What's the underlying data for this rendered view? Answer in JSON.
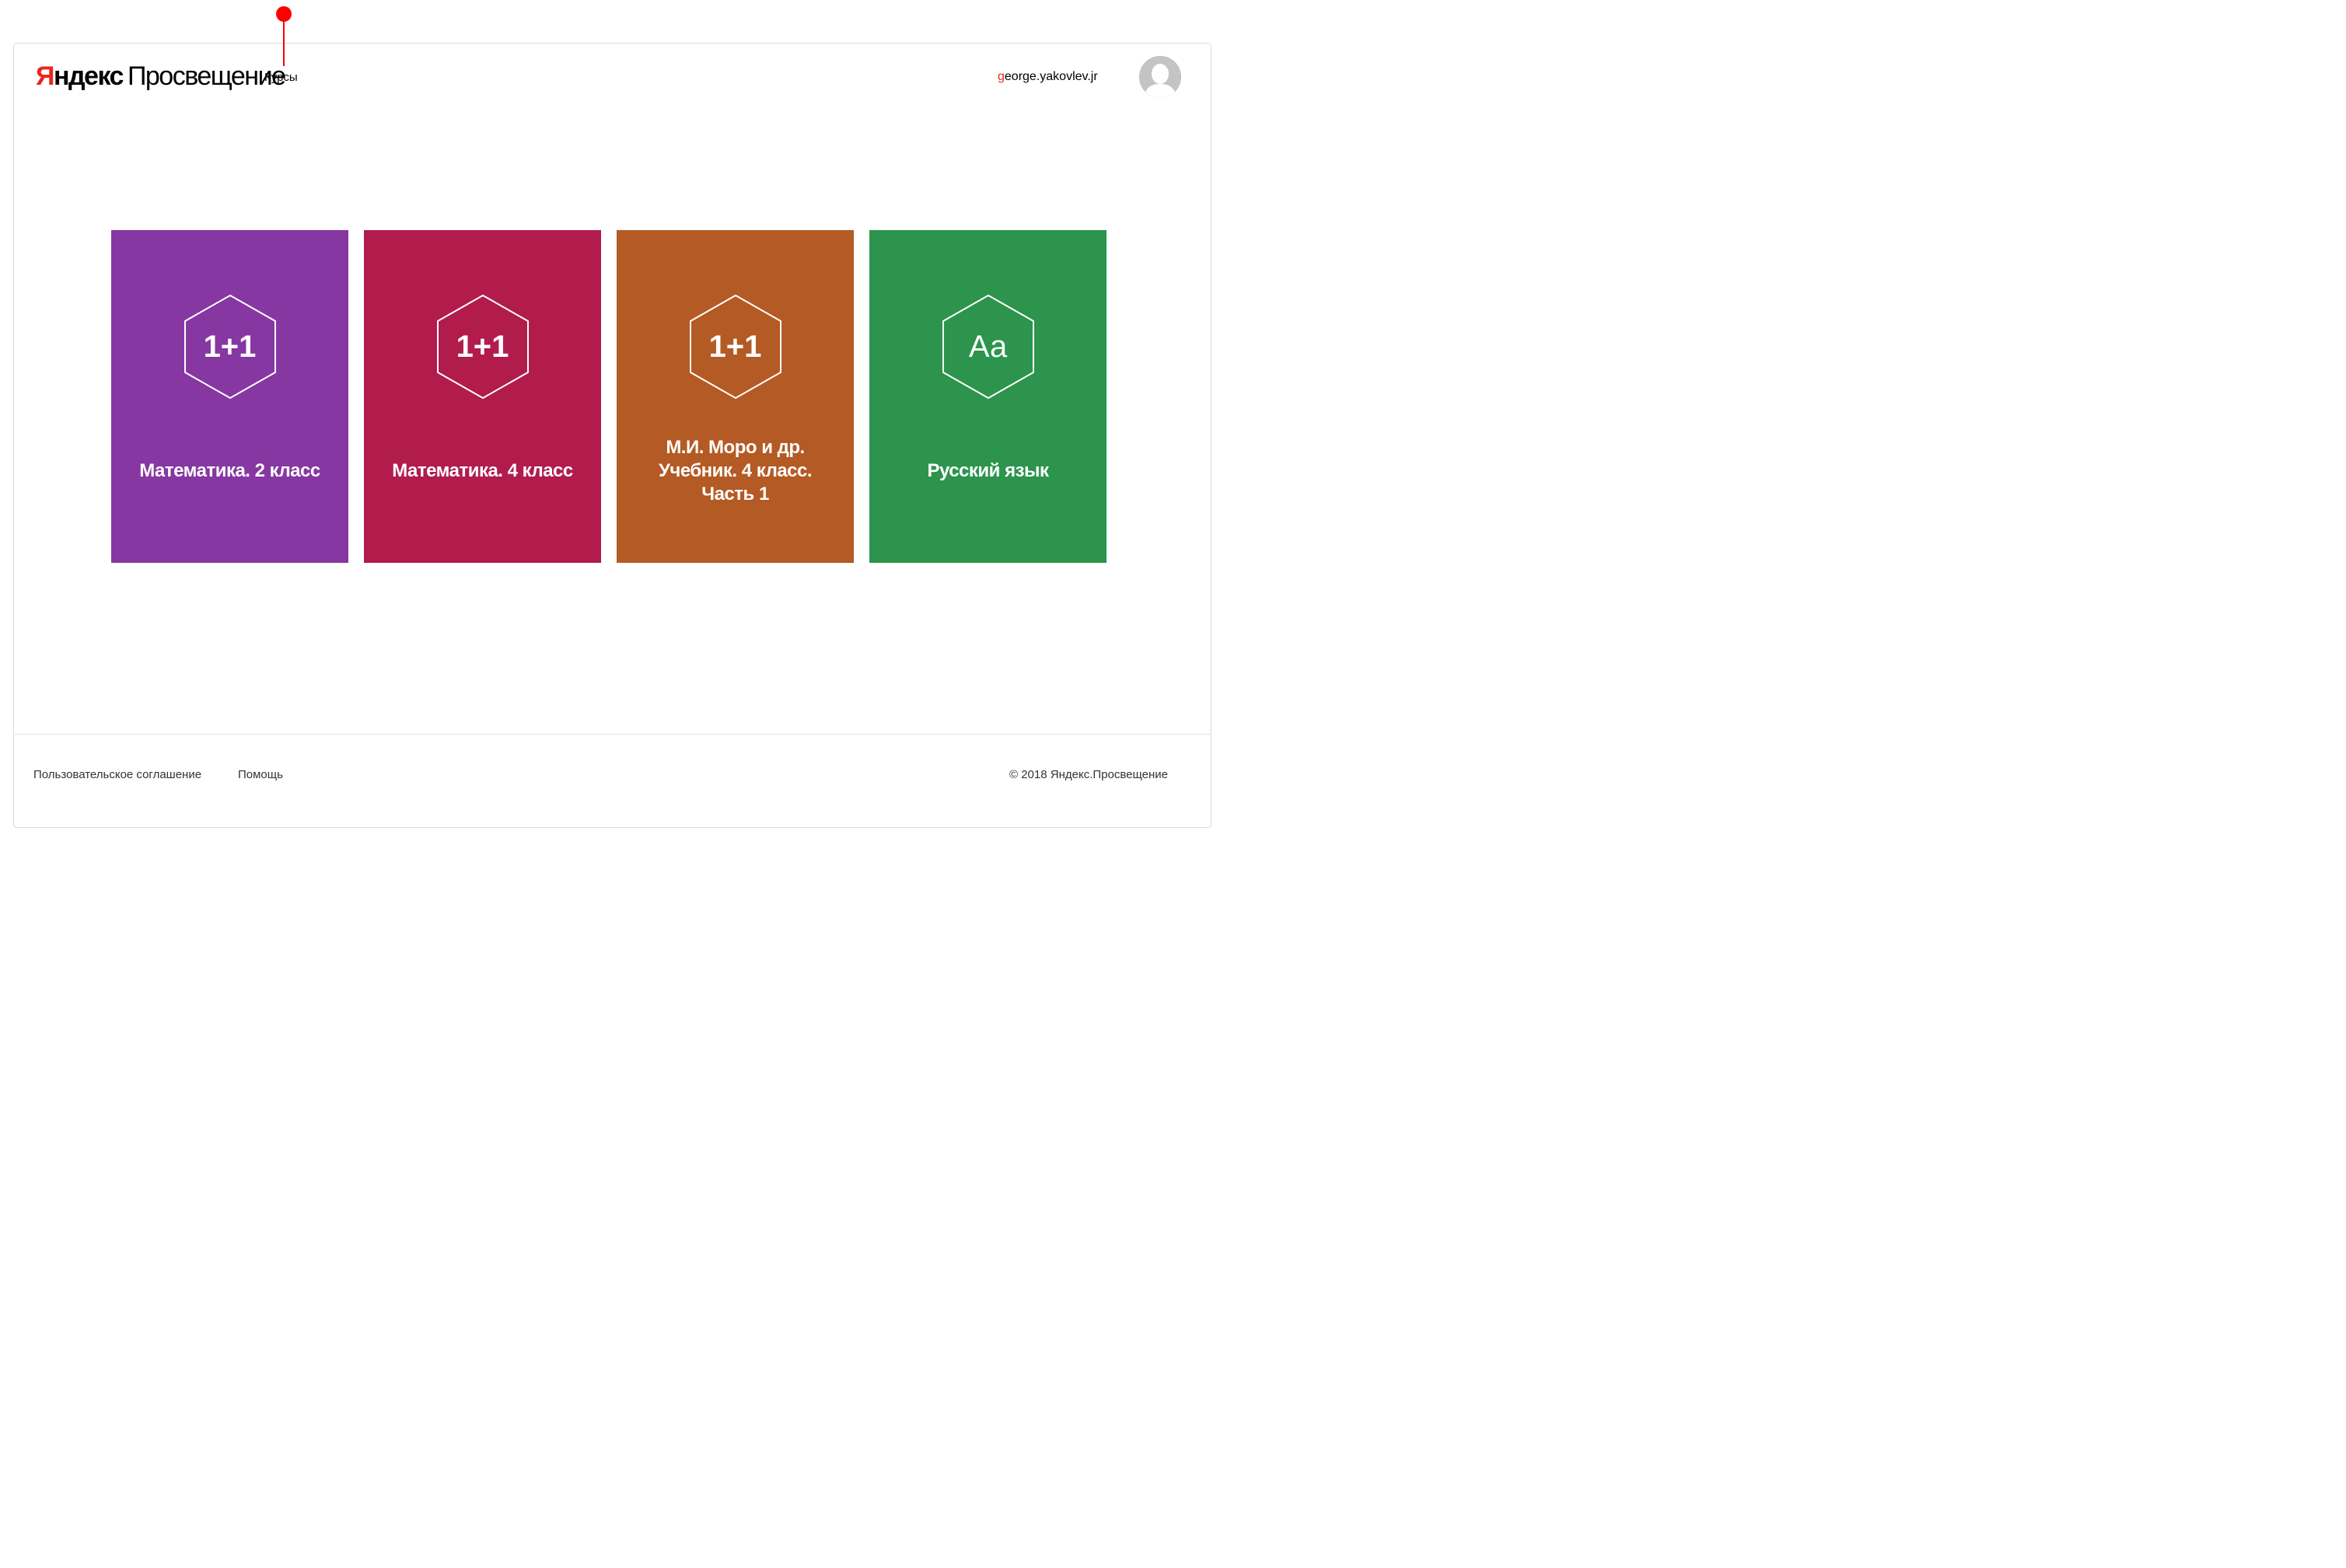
{
  "header": {
    "logo": {
      "brand_ya": "Я",
      "brand_ndex": "ндекс",
      "product": "Просвещение"
    },
    "nav": {
      "courses_label": "Курсы"
    },
    "user": {
      "name_first_letter": "g",
      "name_rest": "eorge.yakovlev.jr"
    }
  },
  "annotation": {
    "marker_color": "#ff0000"
  },
  "courses": [
    {
      "badge": "1+1",
      "title": "Математика. 2 класс",
      "color": "#8637a2",
      "icon": "hexagon-math-icon"
    },
    {
      "badge": "1+1",
      "title": "Математика. 4 класс",
      "color": "#b11c4d",
      "icon": "hexagon-math-icon"
    },
    {
      "badge": "1+1",
      "title": "М.И. Моро и др. Учебник. 4 класс. Часть 1",
      "color": "#b45a24",
      "icon": "hexagon-math-icon"
    },
    {
      "badge": "Аа",
      "title": "Русский язык",
      "color": "#2c944c",
      "icon": "hexagon-letters-icon"
    }
  ],
  "footer": {
    "user_agreement": "Пользовательское соглашение",
    "help": "Помощь",
    "copyright": "© 2018 Яндекс.Просвещение"
  },
  "colors": {
    "brand_red": "#e8271f",
    "avatar_gray": "#c4c4c4"
  }
}
